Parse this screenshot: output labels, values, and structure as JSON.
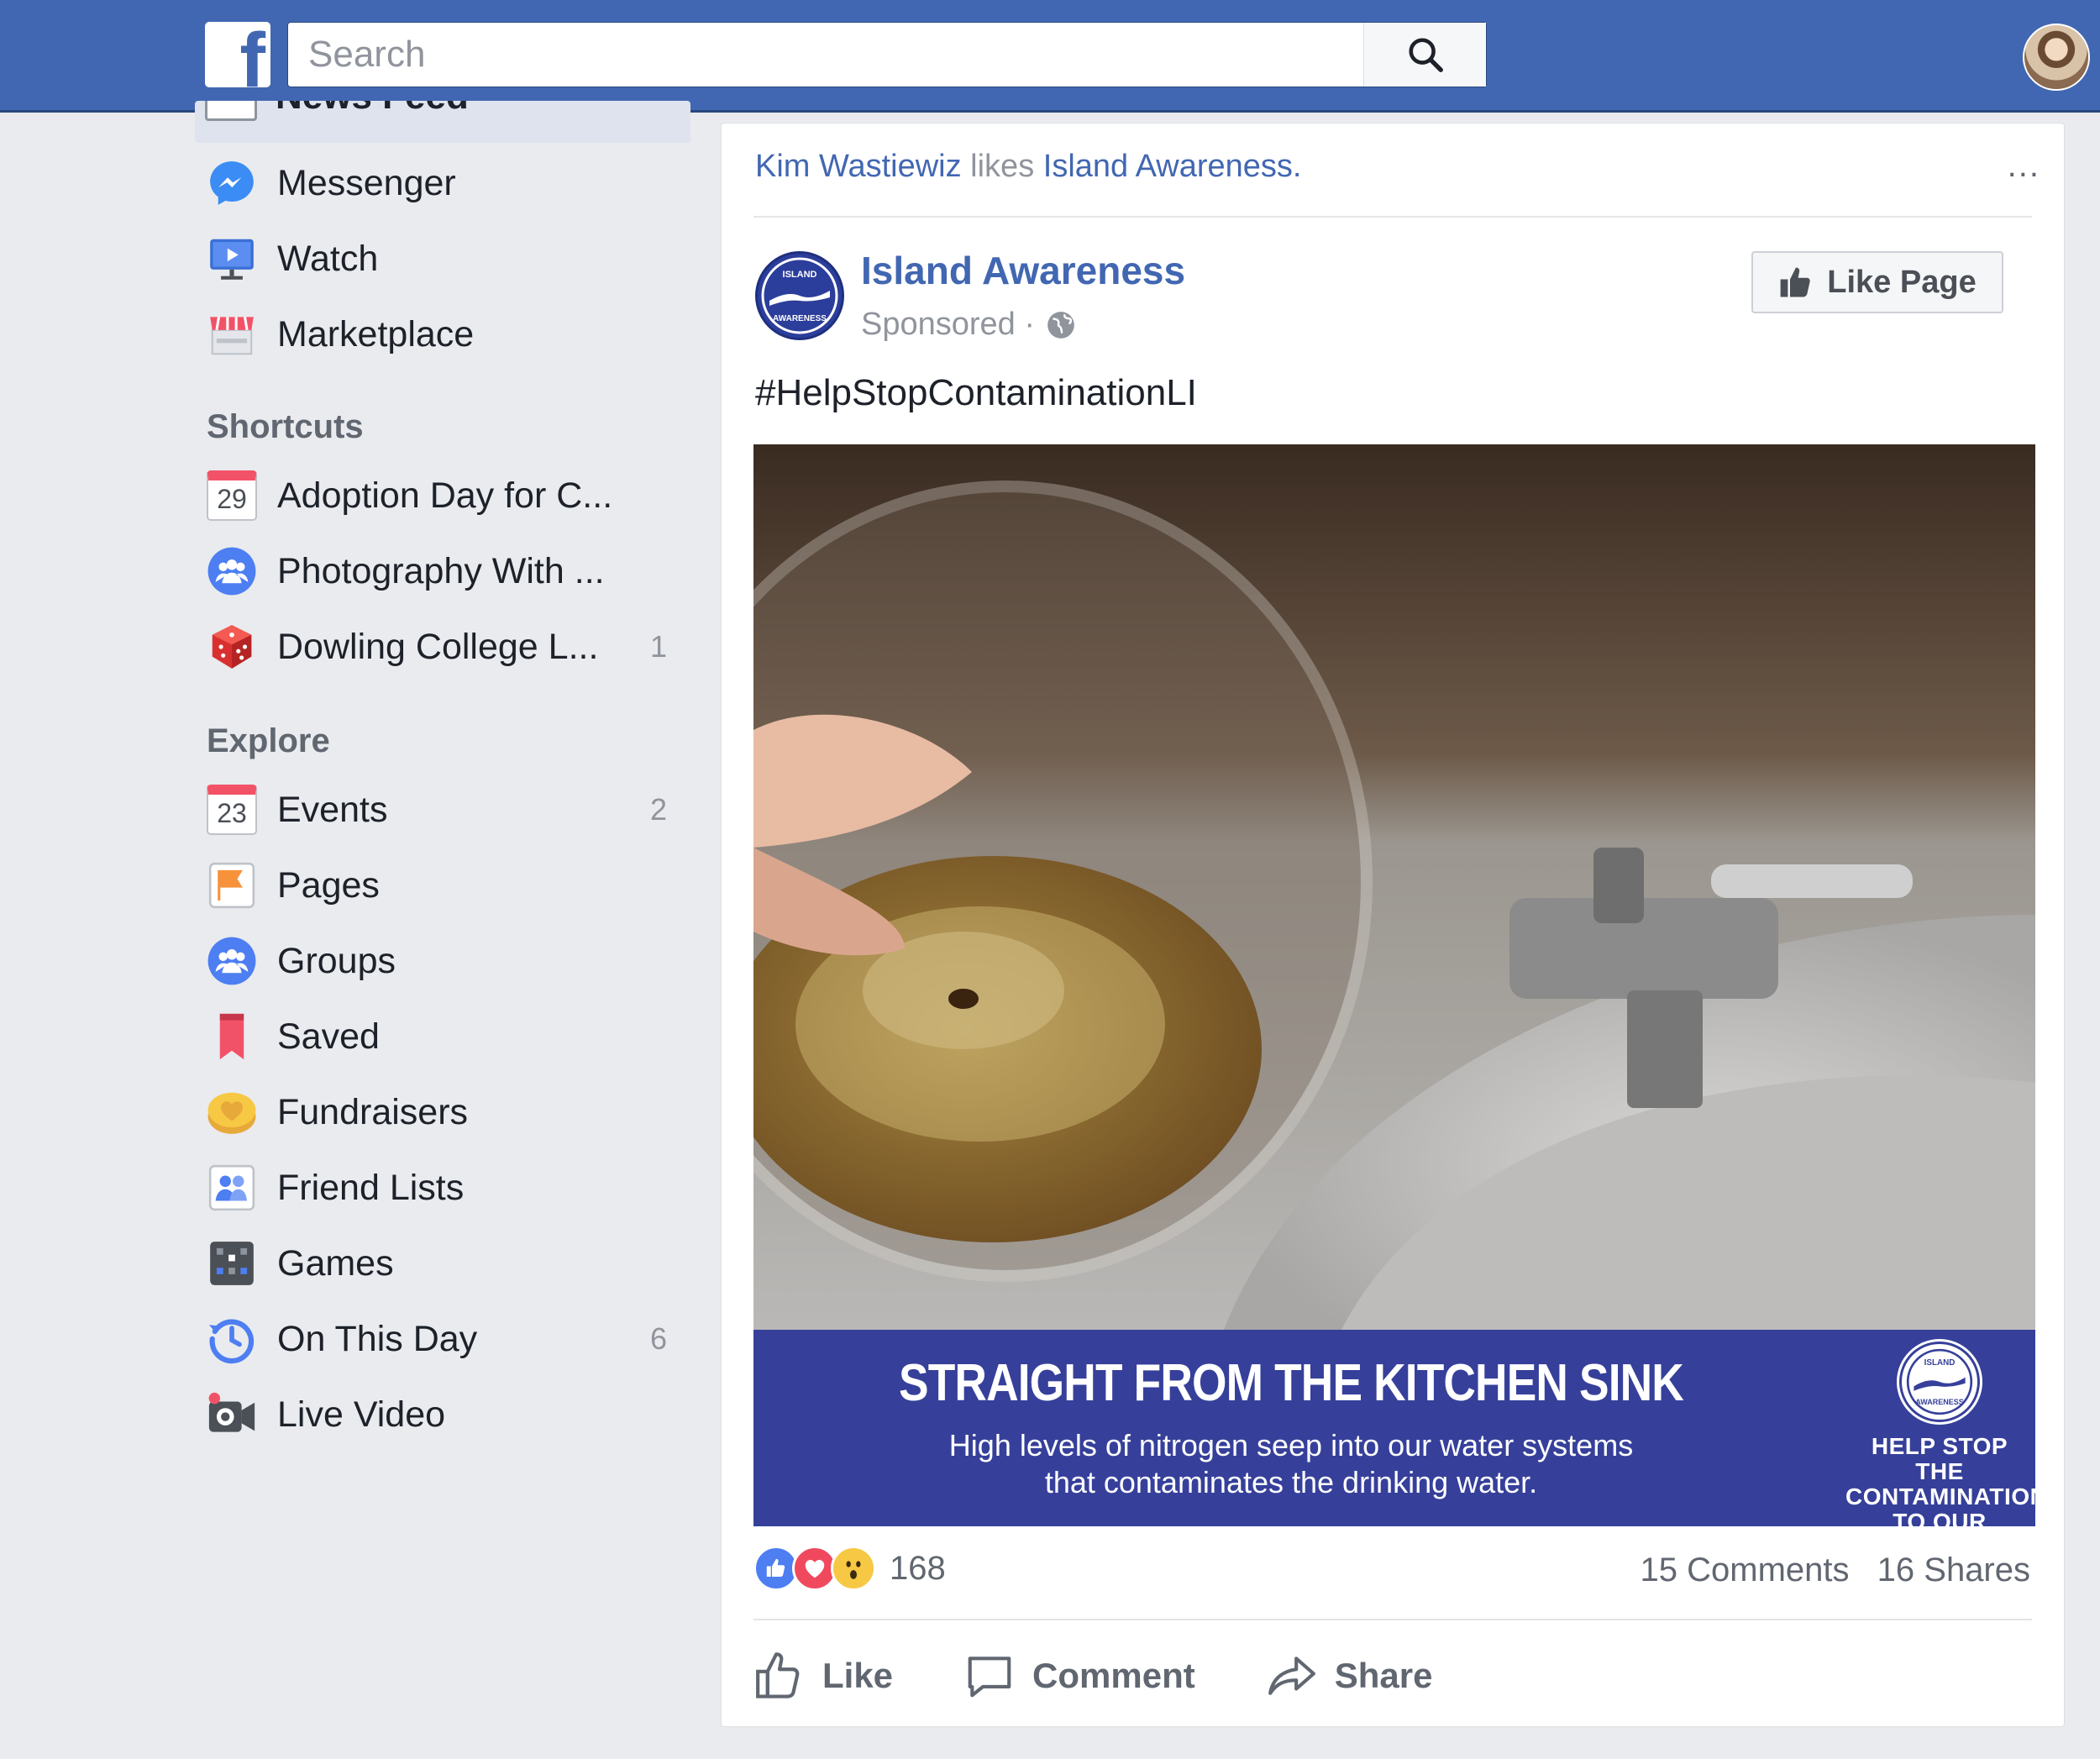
{
  "header": {
    "logo_letter": "f",
    "search_placeholder": "Search"
  },
  "sidebar": {
    "newsfeed_label": "News Feed",
    "items": [
      {
        "label": "Messenger",
        "icon": "messenger-icon"
      },
      {
        "label": "Watch",
        "icon": "watch-icon"
      },
      {
        "label": "Marketplace",
        "icon": "marketplace-icon"
      }
    ],
    "shortcuts_heading": "Shortcuts",
    "shortcuts": [
      {
        "label": "Adoption Day for C...",
        "icon": "calendar-icon",
        "icon_text": "29",
        "count": ""
      },
      {
        "label": "Photography With ...",
        "icon": "group-icon",
        "count": ""
      },
      {
        "label": "Dowling College L...",
        "icon": "dice-icon",
        "count": "1"
      }
    ],
    "explore_heading": "Explore",
    "explore": [
      {
        "label": "Events",
        "icon": "calendar-icon",
        "icon_text": "23",
        "count": "2"
      },
      {
        "label": "Pages",
        "icon": "flag-icon",
        "count": ""
      },
      {
        "label": "Groups",
        "icon": "group-icon",
        "count": ""
      },
      {
        "label": "Saved",
        "icon": "bookmark-icon",
        "count": ""
      },
      {
        "label": "Fundraisers",
        "icon": "fundraiser-icon",
        "count": ""
      },
      {
        "label": "Friend Lists",
        "icon": "friend-list-icon",
        "count": ""
      },
      {
        "label": "Games",
        "icon": "games-icon",
        "count": ""
      },
      {
        "label": "On This Day",
        "icon": "history-icon",
        "count": "6"
      },
      {
        "label": "Live Video",
        "icon": "live-video-icon",
        "count": ""
      }
    ]
  },
  "post": {
    "story_actor": "Kim Wastiewiz",
    "story_verb": "likes",
    "story_object": "Island Awareness.",
    "more_label": "...",
    "page_name": "Island Awareness",
    "sponsored": "Sponsored ·",
    "like_page_label": "Like Page",
    "hashtag": "#HelpStopContaminationLI",
    "logo_top_text": "ISLAND",
    "logo_bottom_text": "AWARENESS",
    "banner_headline": "STRAIGHT FROM THE KITCHEN SINK",
    "banner_sub_line1": "High levels of nitrogen seep into our water systems",
    "banner_sub_line2": "that contaminates the drinking water.",
    "banner_tag_line1": "HELP STOP THE",
    "banner_tag_line2": "CONTAMINATION",
    "banner_tag_line3": "TO OUR WATERS",
    "reaction_count": "168",
    "comments": "15 Comments",
    "shares": "16 Shares",
    "actions": {
      "like": "Like",
      "comment": "Comment",
      "share": "Share"
    },
    "colors": {
      "brand": "#4267b2",
      "banner": "#36409a"
    }
  }
}
